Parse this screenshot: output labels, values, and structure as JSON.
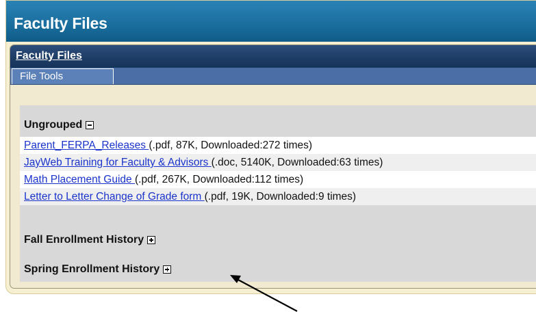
{
  "header": {
    "title": "Faculty Files"
  },
  "portlet": {
    "title": "Faculty Files",
    "tabs": [
      {
        "label": "File Tools"
      }
    ]
  },
  "groups": [
    {
      "name": "Ungrouped",
      "expanded": true,
      "toggle_icon": "collapse-minus-icon",
      "files": [
        {
          "name": "Parent_FERPA_Releases ",
          "meta": "(.pdf, 87K, Downloaded:272 times)"
        },
        {
          "name": "JayWeb Training for Faculty & Advisors ",
          "meta": "(.doc, 5140K, Downloaded:63 times)"
        },
        {
          "name": "Math Placement Guide ",
          "meta": "(.pdf, 267K, Downloaded:112 times)"
        },
        {
          "name": "Letter to Letter Change of Grade form ",
          "meta": "(.pdf, 19K, Downloaded:9 times)"
        }
      ]
    },
    {
      "name": "Fall Enrollment History",
      "expanded": false,
      "toggle_icon": "expand-plus-icon"
    },
    {
      "name": "Spring Enrollment History",
      "expanded": false,
      "toggle_icon": "expand-plus-icon"
    }
  ],
  "annotation": {
    "icon": "pointer-arrow-icon",
    "color": "#000000"
  }
}
